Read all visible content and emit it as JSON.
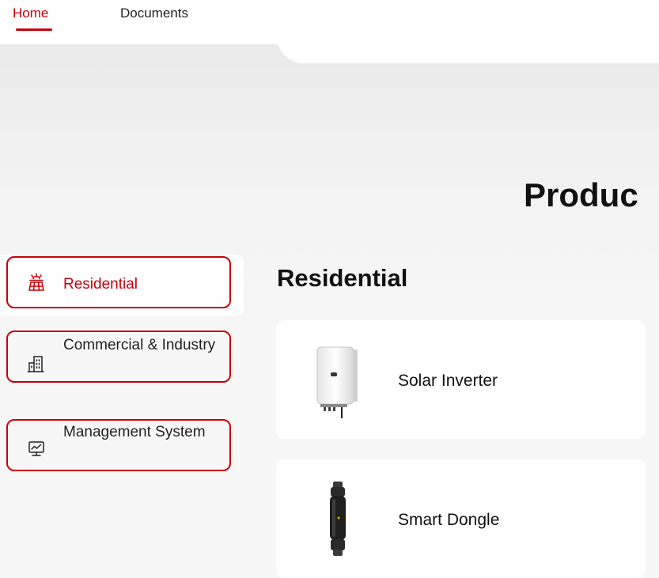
{
  "nav": {
    "tabs": [
      {
        "label": "Home",
        "active": true
      },
      {
        "label": "Documents",
        "active": false
      }
    ]
  },
  "hero": {
    "title": "Produc"
  },
  "sidebar": {
    "items": [
      {
        "label": "Residential",
        "icon": "solar-panel-icon",
        "active": true
      },
      {
        "label": "Commercial & Industry",
        "icon": "building-icon",
        "active": false
      },
      {
        "label": "Management System",
        "icon": "monitor-chart-icon",
        "active": false
      }
    ]
  },
  "main": {
    "section_title": "Residential",
    "products": [
      {
        "label": "Solar Inverter",
        "icon": "inverter-image"
      },
      {
        "label": "Smart Dongle",
        "icon": "dongle-image"
      }
    ]
  },
  "colors": {
    "accent": "#c7000b",
    "background": "#f7f7f7",
    "card": "#ffffff"
  }
}
